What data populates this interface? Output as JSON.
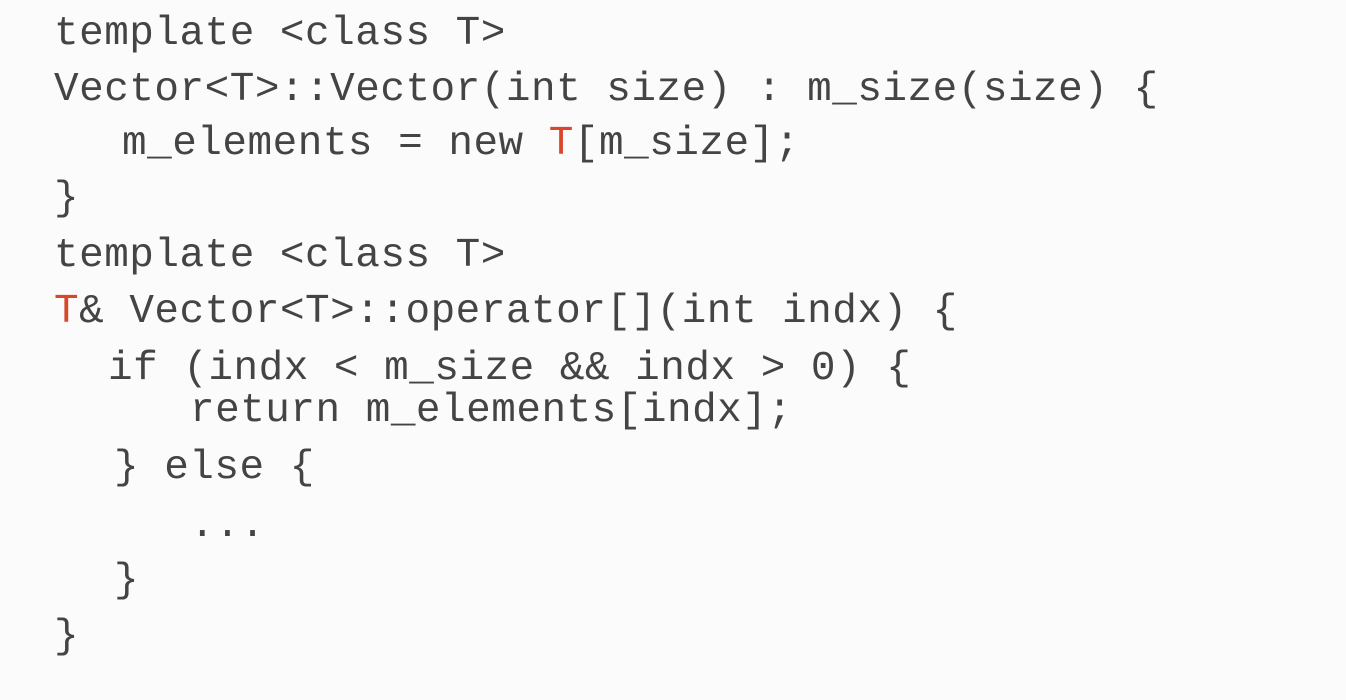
{
  "code": {
    "colors": {
      "text": "#444444",
      "highlight": "#d9472b",
      "background": "#fbfbfb"
    },
    "lines": {
      "l1": {
        "text": "template <class T>"
      },
      "l2": {
        "text": "Vector<T>::Vector(int size) : m_size(size) {"
      },
      "l3": {
        "pre": "m_elements = new ",
        "hl": "T",
        "post": "[m_size];"
      },
      "l4": {
        "text": "}"
      },
      "l5": {
        "text": "template <class T>"
      },
      "l6": {
        "hl": "T",
        "post": "& Vector<T>::operator[](int indx) {"
      },
      "l7": {
        "text": "if (indx < m_size && indx > 0) {"
      },
      "l8": {
        "text": "return m_elements[indx];"
      },
      "l9": {
        "text": "} else {"
      },
      "l10": {
        "text": "..."
      },
      "l11": {
        "text": "}"
      },
      "l12": {
        "text": "}"
      }
    }
  }
}
